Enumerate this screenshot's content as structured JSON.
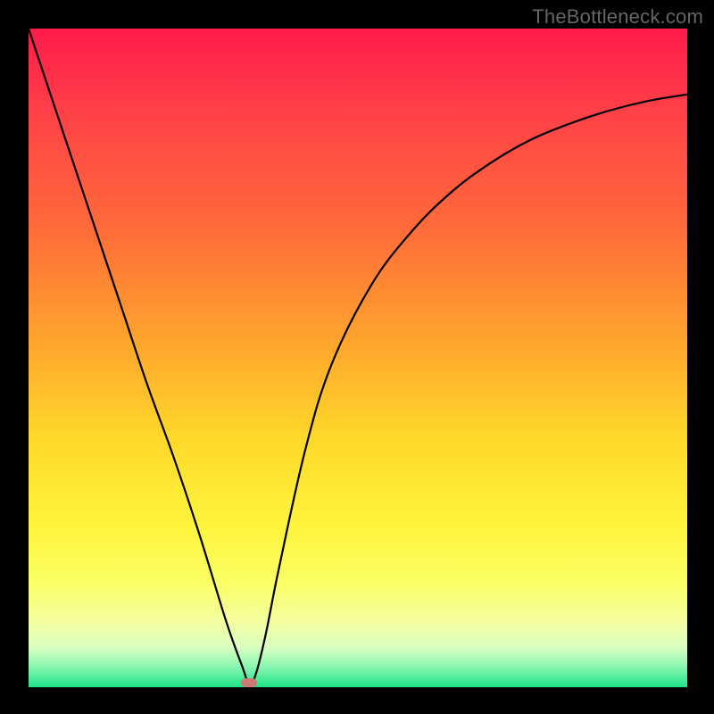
{
  "watermark": "TheBottleneck.com",
  "colors": {
    "gradient_stops": [
      {
        "offset": 0.0,
        "color": "#ff1a4b"
      },
      {
        "offset": 0.12,
        "color": "#ff3f48"
      },
      {
        "offset": 0.3,
        "color": "#ff6a3a"
      },
      {
        "offset": 0.48,
        "color": "#ffa62c"
      },
      {
        "offset": 0.62,
        "color": "#ffd82a"
      },
      {
        "offset": 0.75,
        "color": "#fff33a"
      },
      {
        "offset": 0.84,
        "color": "#fbff63"
      },
      {
        "offset": 0.9,
        "color": "#f4ffa0"
      },
      {
        "offset": 0.94,
        "color": "#d8ffc0"
      },
      {
        "offset": 0.97,
        "color": "#86f6b0"
      },
      {
        "offset": 1.0,
        "color": "#1fe38a"
      }
    ],
    "curve": "#000000",
    "marker": "#cd7a74",
    "frame": "#000000"
  },
  "chart_data": {
    "type": "line",
    "title": "",
    "xlabel": "",
    "ylabel": "",
    "xlim": [
      0,
      100
    ],
    "ylim": [
      0,
      100
    ],
    "series": [
      {
        "name": "bottleneck-curve",
        "x": [
          0,
          6,
          10,
          14,
          18,
          22,
          26,
          30,
          32.5,
          33.5,
          34.5,
          36,
          38,
          42,
          46,
          52,
          58,
          64,
          70,
          76,
          82,
          88,
          94,
          100
        ],
        "y": [
          100,
          82,
          70,
          58,
          46,
          35,
          23,
          10,
          3,
          0.5,
          2,
          8,
          18,
          36,
          49,
          61,
          69,
          75,
          79.5,
          83,
          85.5,
          87.5,
          89,
          90
        ]
      }
    ],
    "annotations": [
      {
        "name": "optimal-point",
        "x": 33.5,
        "y": 0.5
      }
    ]
  }
}
